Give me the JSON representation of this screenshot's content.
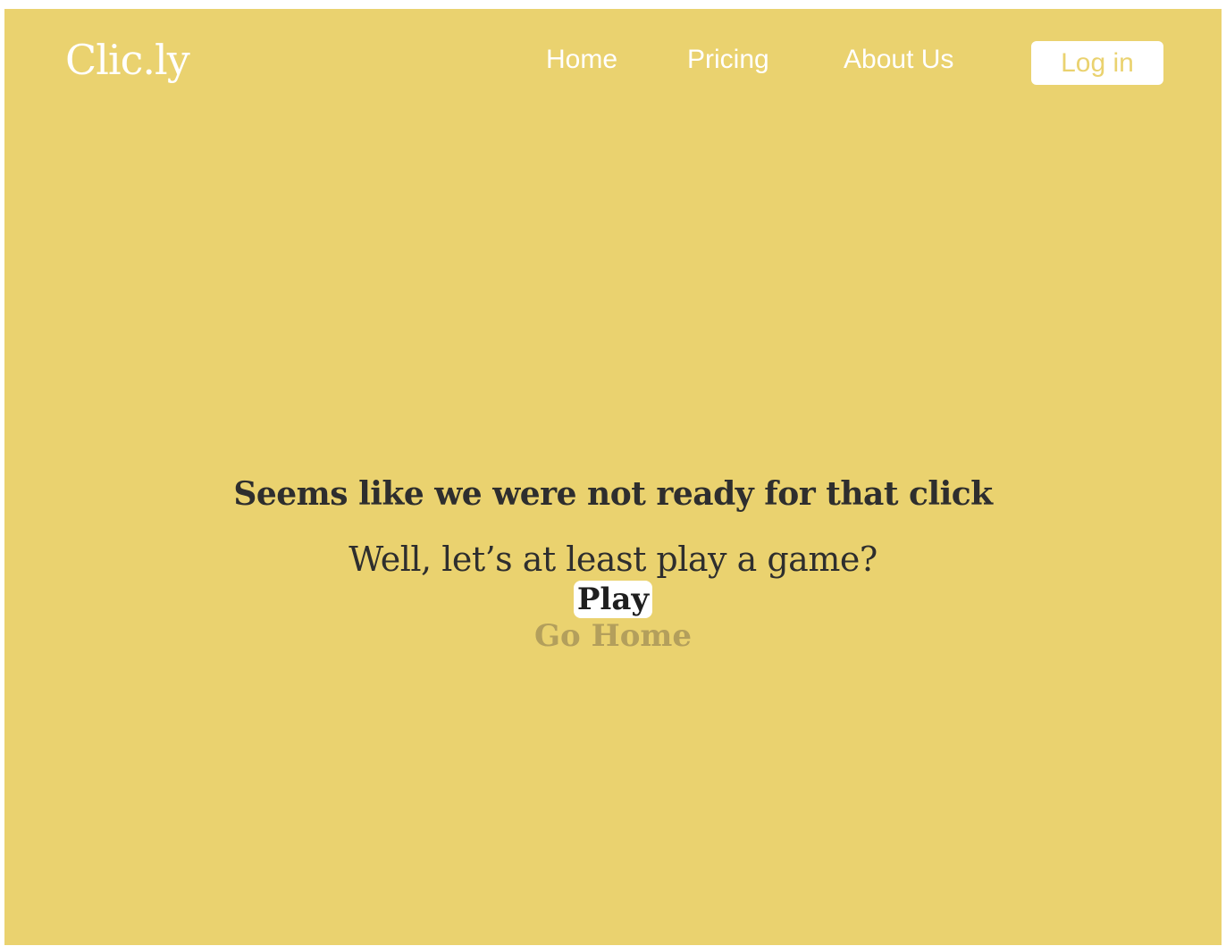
{
  "header": {
    "logo": "Clic.ly",
    "nav": [
      {
        "label": "Home"
      },
      {
        "label": "Pricing"
      },
      {
        "label": "About Us"
      }
    ],
    "login_label": "Log in"
  },
  "main": {
    "heading": "Seems like we were not ready for that click",
    "subheading": "Well, let’s at least play a game?",
    "play_label": "Play",
    "go_home_label": "Go Home"
  },
  "colors": {
    "background": "#ead26f",
    "text": "#2e2e2e",
    "muted_link": "#b39f5c",
    "white": "#ffffff"
  }
}
